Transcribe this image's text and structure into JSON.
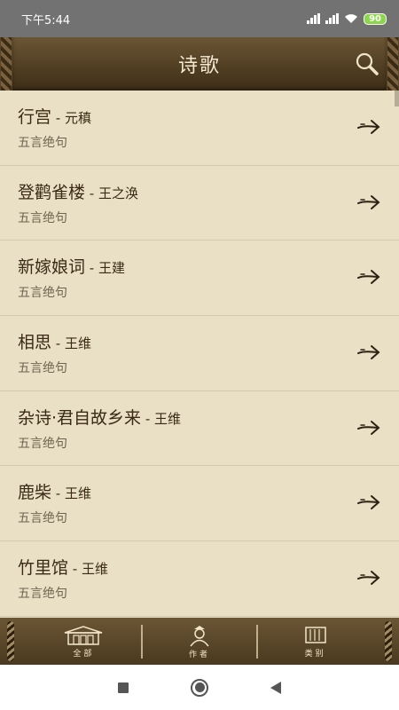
{
  "status_bar": {
    "time": "下午5:44",
    "battery": "90"
  },
  "header": {
    "title": "诗歌"
  },
  "poems": [
    {
      "title": "行宫",
      "author": "元稹",
      "category": "五言绝句"
    },
    {
      "title": "登鹳雀楼",
      "author": "王之涣",
      "category": "五言绝句"
    },
    {
      "title": "新嫁娘词",
      "author": "王建",
      "category": "五言绝句"
    },
    {
      "title": "相思",
      "author": "王维",
      "category": "五言绝句"
    },
    {
      "title": "杂诗·君自故乡来",
      "author": "王维",
      "category": "五言绝句"
    },
    {
      "title": "鹿柴",
      "author": "王维",
      "category": "五言绝句"
    },
    {
      "title": "竹里馆",
      "author": "王维",
      "category": "五言绝句"
    }
  ],
  "separator": " - ",
  "tabs": [
    {
      "label": "全部",
      "icon": "building-icon"
    },
    {
      "label": "作者",
      "icon": "scholar-icon"
    },
    {
      "label": "类别",
      "icon": "scroll-icon"
    }
  ],
  "colors": {
    "accent_brown": "#4f3d22",
    "list_bg": "#e9e0c6",
    "text_dark": "#3a2a16"
  }
}
